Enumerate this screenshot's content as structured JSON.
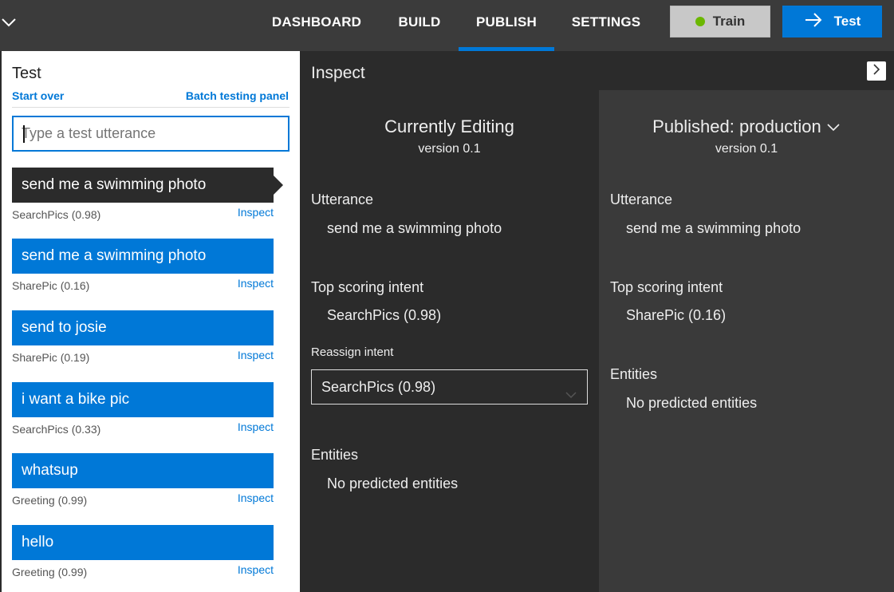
{
  "nav": {
    "dashboard": "DASHBOARD",
    "build": "BUILD",
    "publish": "PUBLISH",
    "settings": "SETTINGS",
    "active": "PUBLISH",
    "train_label": "Train",
    "test_label": "Test"
  },
  "colors": {
    "accent": "#0078d7",
    "train_status": "#6bb700"
  },
  "test_panel": {
    "title": "Test",
    "start_over": "Start over",
    "batch_panel": "Batch testing panel",
    "input_placeholder": "Type a test utterance",
    "items": [
      {
        "text": "send me a swimming photo",
        "intent": "SearchPics (0.98)",
        "inspect": "Inspect",
        "selected": true
      },
      {
        "text": "send me a swimming photo",
        "intent": "SharePic (0.16)",
        "inspect": "Inspect"
      },
      {
        "text": "send to josie",
        "intent": "SharePic (0.19)",
        "inspect": "Inspect"
      },
      {
        "text": "i want a bike pic",
        "intent": "SearchPics (0.33)",
        "inspect": "Inspect"
      },
      {
        "text": "whatsup",
        "intent": "Greeting (0.99)",
        "inspect": "Inspect"
      },
      {
        "text": "hello",
        "intent": "Greeting (0.99)",
        "inspect": "Inspect"
      }
    ]
  },
  "inspect": {
    "title": "Inspect",
    "editing": {
      "heading": "Currently Editing",
      "version": "version 0.1",
      "utterance_label": "Utterance",
      "utterance": "send me a swimming photo",
      "top_intent_label": "Top scoring intent",
      "top_intent": "SearchPics (0.98)",
      "reassign_label": "Reassign intent",
      "reassign_value": "SearchPics (0.98)",
      "entities_label": "Entities",
      "entities": "No predicted entities"
    },
    "published": {
      "heading": "Published: production",
      "version": "version 0.1",
      "utterance_label": "Utterance",
      "utterance": "send me a swimming photo",
      "top_intent_label": "Top scoring intent",
      "top_intent": "SharePic (0.16)",
      "entities_label": "Entities",
      "entities": "No predicted entities"
    }
  }
}
